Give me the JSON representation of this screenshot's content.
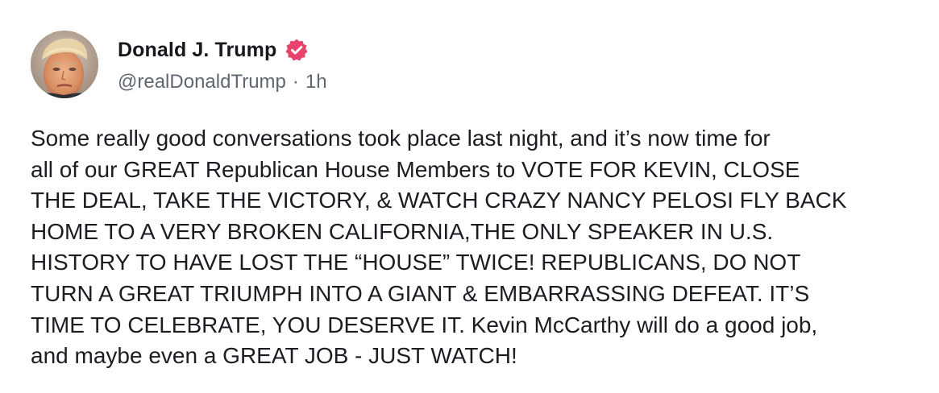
{
  "post": {
    "author": {
      "display_name": "Donald J. Trump",
      "handle": "@realDonaldTrump",
      "verified_icon": "verified-badge-icon",
      "avatar_icon": "profile-photo"
    },
    "meta": {
      "separator": "·",
      "time_ago": "1h"
    },
    "body_lines": [
      "Some really good conversations took place last night, and it’s now time for",
      "all of our GREAT Republican House Members to VOTE FOR KEVIN, CLOSE",
      "THE DEAL, TAKE THE VICTORY, & WATCH CRAZY NANCY PELOSI FLY BACK",
      "HOME TO A VERY BROKEN CALIFORNIA,THE ONLY SPEAKER IN U.S.",
      "HISTORY TO HAVE LOST THE “HOUSE” TWICE! REPUBLICANS, DO NOT",
      "TURN A GREAT TRIUMPH INTO A GIANT & EMBARRASSING DEFEAT. IT’S",
      "TIME TO CELEBRATE, YOU DESERVE IT. Kevin McCarthy will do a good job,",
      "and maybe even a GREAT JOB - JUST WATCH!"
    ]
  },
  "colors": {
    "text": "#1b1d23",
    "secondary_text": "#606770",
    "verified_badge": "#e8446b",
    "background": "#ffffff"
  }
}
